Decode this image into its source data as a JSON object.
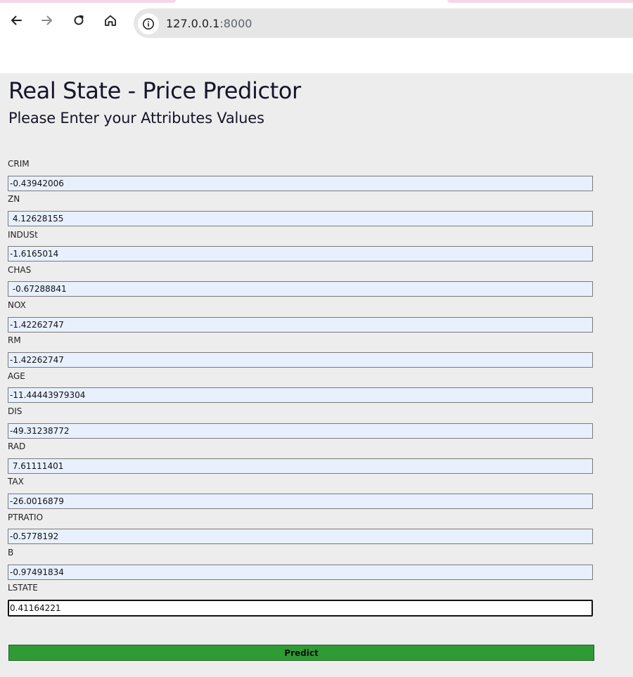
{
  "browser": {
    "url_host": "127.0.0.1",
    "url_port": ":8000",
    "back_icon": "arrow-left-icon",
    "forward_icon": "arrow-right-icon",
    "reload_icon": "reload-icon",
    "home_icon": "home-icon",
    "site_info_icon": "info-icon"
  },
  "page": {
    "title": "Real State - Price Predictor",
    "subtitle": "Please Enter your Attributes Values"
  },
  "form": {
    "fields": [
      {
        "label": "CRIM",
        "value": "-0.43942006"
      },
      {
        "label": "ZN",
        "value": " 4.12628155"
      },
      {
        "label": "INDUSt",
        "value": "-1.6165014"
      },
      {
        "label": "CHAS",
        "value": " -0.67288841"
      },
      {
        "label": "NOX",
        "value": "-1.42262747"
      },
      {
        "label": "RM",
        "value": "-1.42262747"
      },
      {
        "label": "AGE",
        "value": "-11.44443979304"
      },
      {
        "label": "DIS",
        "value": "-49.31238772"
      },
      {
        "label": "RAD",
        "value": " 7.61111401"
      },
      {
        "label": "TAX",
        "value": "-26.0016879"
      },
      {
        "label": "PTRATIO",
        "value": "-0.5778192"
      },
      {
        "label": "B",
        "value": "-0.97491834"
      },
      {
        "label": "LSTATE",
        "value": "0.41164221"
      }
    ],
    "submit_label": "Predict"
  },
  "colors": {
    "page_background": "#ededed",
    "input_background": "#e8f0fe",
    "button_background": "#2f9b35"
  }
}
